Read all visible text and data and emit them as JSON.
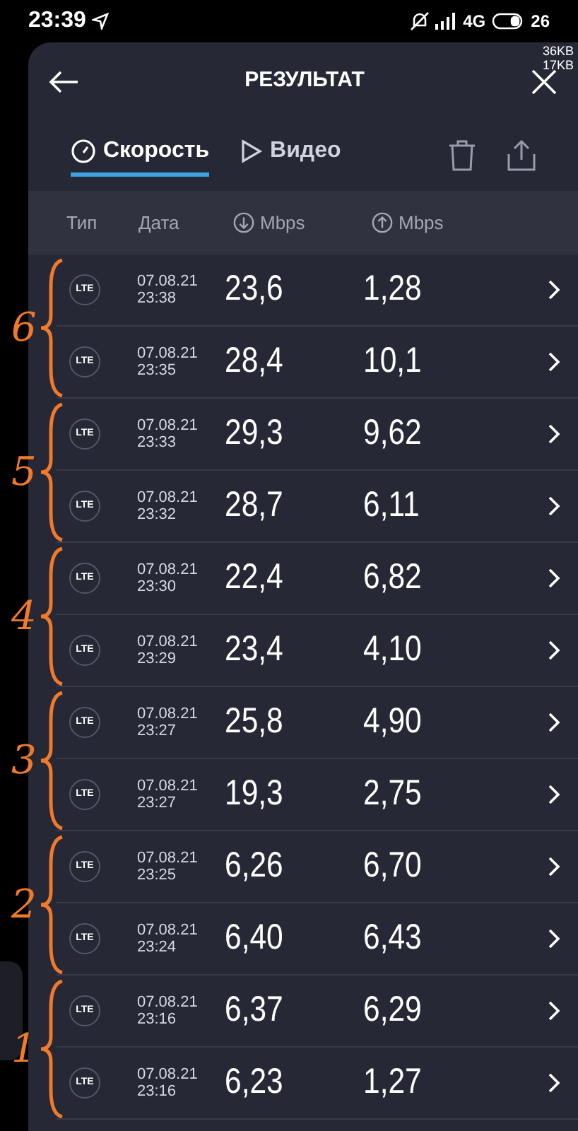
{
  "status_bar": {
    "time": "23:39",
    "network": "4G",
    "battery": "26",
    "speed_down": "36KB",
    "speed_up": "17KB"
  },
  "header": {
    "title": "РЕЗУЛЬТАТ"
  },
  "tabs": [
    {
      "label": "Скорость",
      "selected": true,
      "kind": "speed"
    },
    {
      "label": "Видео",
      "selected": false,
      "kind": "video"
    }
  ],
  "table": {
    "columns": [
      "Тип",
      "Дата",
      "Mbps",
      "Mbps"
    ],
    "rows": [
      {
        "type": "LTE",
        "date": "07.08.21",
        "time": "23:38",
        "down": "23,6",
        "up": "1,28"
      },
      {
        "type": "LTE",
        "date": "07.08.21",
        "time": "23:35",
        "down": "28,4",
        "up": "10,1"
      },
      {
        "type": "LTE",
        "date": "07.08.21",
        "time": "23:33",
        "down": "29,3",
        "up": "9,62"
      },
      {
        "type": "LTE",
        "date": "07.08.21",
        "time": "23:32",
        "down": "28,7",
        "up": "6,11"
      },
      {
        "type": "LTE",
        "date": "07.08.21",
        "time": "23:30",
        "down": "22,4",
        "up": "6,82"
      },
      {
        "type": "LTE",
        "date": "07.08.21",
        "time": "23:29",
        "down": "23,4",
        "up": "4,10"
      },
      {
        "type": "LTE",
        "date": "07.08.21",
        "time": "23:27",
        "down": "25,8",
        "up": "4,90"
      },
      {
        "type": "LTE",
        "date": "07.08.21",
        "time": "23:27",
        "down": "19,3",
        "up": "2,75"
      },
      {
        "type": "LTE",
        "date": "07.08.21",
        "time": "23:25",
        "down": "6,26",
        "up": "6,70"
      },
      {
        "type": "LTE",
        "date": "07.08.21",
        "time": "23:24",
        "down": "6,40",
        "up": "6,43"
      },
      {
        "type": "LTE",
        "date": "07.08.21",
        "time": "23:16",
        "down": "6,37",
        "up": "6,29"
      },
      {
        "type": "LTE",
        "date": "07.08.21",
        "time": "23:16",
        "down": "6,23",
        "up": "1,27"
      }
    ]
  },
  "annotations": [
    {
      "label": "6"
    },
    {
      "label": "5"
    },
    {
      "label": "4"
    },
    {
      "label": "3"
    },
    {
      "label": "2"
    },
    {
      "label": "1"
    }
  ]
}
